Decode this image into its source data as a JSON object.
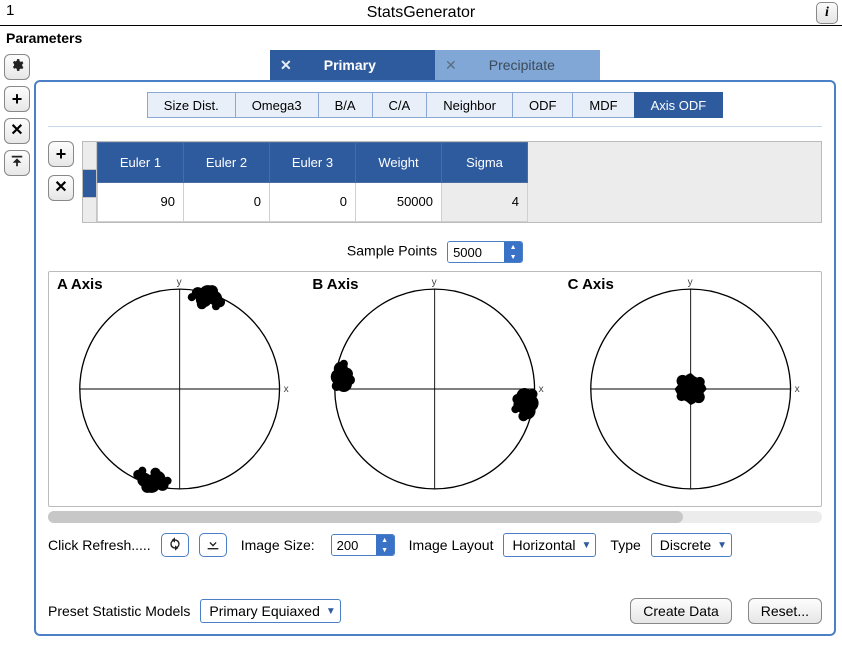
{
  "window": {
    "left_number": "1",
    "title": "StatsGenerator"
  },
  "parameters_label": "Parameters",
  "top_tabs": [
    {
      "label": "Primary",
      "active": true
    },
    {
      "label": "Precipitate",
      "active": false
    }
  ],
  "sub_tabs": [
    {
      "label": "Size Dist.",
      "active": false
    },
    {
      "label": "Omega3",
      "active": false
    },
    {
      "label": "B/A",
      "active": false
    },
    {
      "label": "C/A",
      "active": false
    },
    {
      "label": "Neighbor",
      "active": false
    },
    {
      "label": "ODF",
      "active": false
    },
    {
      "label": "MDF",
      "active": false
    },
    {
      "label": "Axis ODF",
      "active": true
    }
  ],
  "euler_table": {
    "headers": [
      "Euler 1",
      "Euler 2",
      "Euler 3",
      "Weight",
      "Sigma"
    ],
    "rows": [
      {
        "euler1": "90",
        "euler2": "0",
        "euler3": "0",
        "weight": "50000",
        "sigma": "4",
        "sigma_readonly": true
      }
    ]
  },
  "sample_points": {
    "label": "Sample Points",
    "value": "5000"
  },
  "plots": {
    "a_axis": "A Axis",
    "b_axis": "B Axis",
    "c_axis": "C Axis"
  },
  "controls": {
    "refresh_label": "Click Refresh.....",
    "image_size_label": "Image Size:",
    "image_size_value": "200",
    "image_layout_label": "Image Layout",
    "image_layout_value": "Horizontal",
    "type_label": "Type",
    "type_value": "Discrete"
  },
  "bottom": {
    "preset_label": "Preset Statistic Models",
    "preset_value": "Primary Equiaxed",
    "create_data": "Create Data",
    "reset": "Reset..."
  }
}
